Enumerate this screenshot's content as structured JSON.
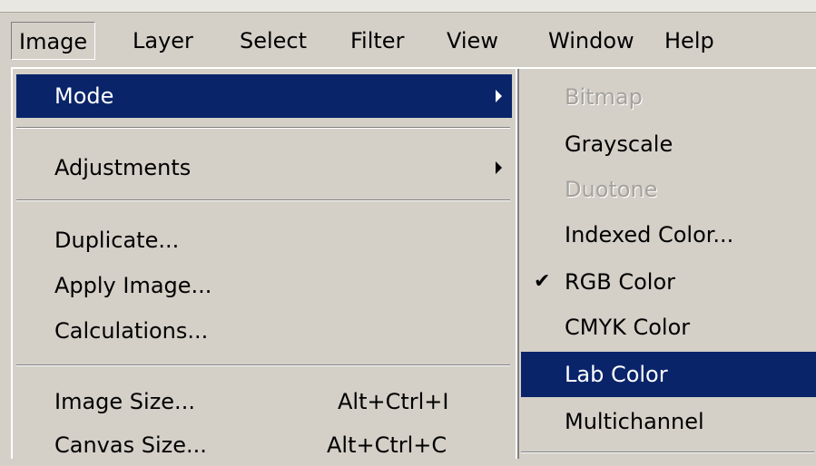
{
  "menubar": {
    "items": [
      {
        "label": "Image"
      },
      {
        "label": "Layer"
      },
      {
        "label": "Select"
      },
      {
        "label": "Filter"
      },
      {
        "label": "View"
      },
      {
        "label": "Window"
      },
      {
        "label": "Help"
      }
    ]
  },
  "image_menu": {
    "items": [
      {
        "label": "Mode"
      },
      {
        "label": "Adjustments"
      },
      {
        "label": "Duplicate..."
      },
      {
        "label": "Apply Image..."
      },
      {
        "label": "Calculations..."
      },
      {
        "label": "Image Size...",
        "shortcut": "Alt+Ctrl+I"
      },
      {
        "label": "Canvas Size...",
        "shortcut": "Alt+Ctrl+C"
      }
    ]
  },
  "mode_menu": {
    "items": [
      {
        "label": "Bitmap",
        "state": "disabled"
      },
      {
        "label": "Grayscale"
      },
      {
        "label": "Duotone",
        "state": "disabled"
      },
      {
        "label": "Indexed Color..."
      },
      {
        "label": "RGB Color",
        "state": "checked"
      },
      {
        "label": "CMYK Color"
      },
      {
        "label": "Lab Color",
        "state": "highlighted"
      },
      {
        "label": "Multichannel"
      }
    ]
  },
  "colors": {
    "highlight": "#0a246a",
    "menu_background": "#d4d0c8",
    "disabled_text": "#a5a29c"
  },
  "icons": {
    "submenu_arrow": "chevron-right-icon",
    "check": "check-icon"
  }
}
